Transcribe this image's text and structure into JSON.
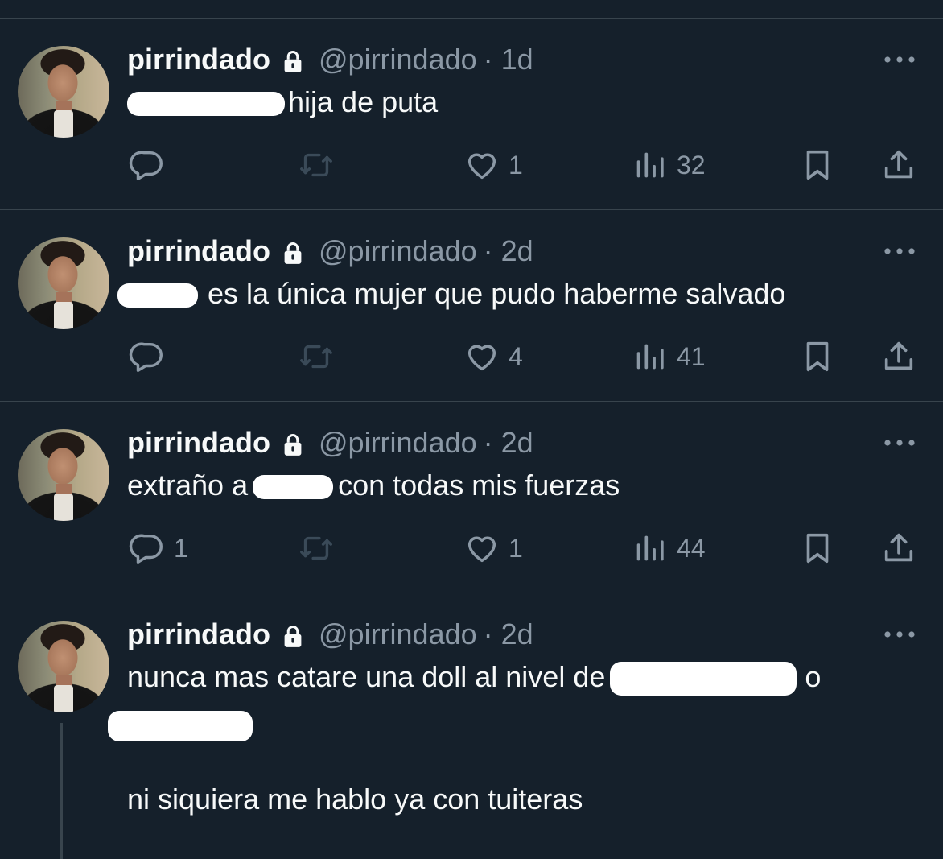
{
  "tweets": [
    {
      "name": "pirrindado",
      "handle": "@pirrindado",
      "time": "· 1d",
      "text_after": "hija de puta",
      "reply_count": "",
      "like_count": "1",
      "view_count": "32"
    },
    {
      "name": "pirrindado",
      "handle": "@pirrindado",
      "time": "· 2d",
      "text_after": "es la única mujer que pudo haberme salvado",
      "reply_count": "",
      "like_count": "4",
      "view_count": "41"
    },
    {
      "name": "pirrindado",
      "handle": "@pirrindado",
      "time": "· 2d",
      "text_before": "extraño a",
      "text_after": "con todas mis fuerzas",
      "reply_count": "1",
      "like_count": "1",
      "view_count": "44"
    },
    {
      "name": "pirrindado",
      "handle": "@pirrindado",
      "time": "· 2d",
      "text_before": "nunca mas catare una doll al nivel de",
      "text_mid": "o",
      "text_line3": "ni siquiera me hablo ya con tuiteras"
    }
  ],
  "icons": {
    "reply": "reply-icon",
    "retweet": "retweet-icon",
    "like": "heart-icon",
    "views": "views-icon",
    "bookmark": "bookmark-icon",
    "share": "share-icon",
    "lock": "lock-icon",
    "more": "more-icon"
  },
  "colors": {
    "background": "#15202b",
    "text": "#f7f9f9",
    "secondary": "#8b98a5",
    "retweet_disabled": "#3a4a58",
    "divider": "#38444d"
  }
}
